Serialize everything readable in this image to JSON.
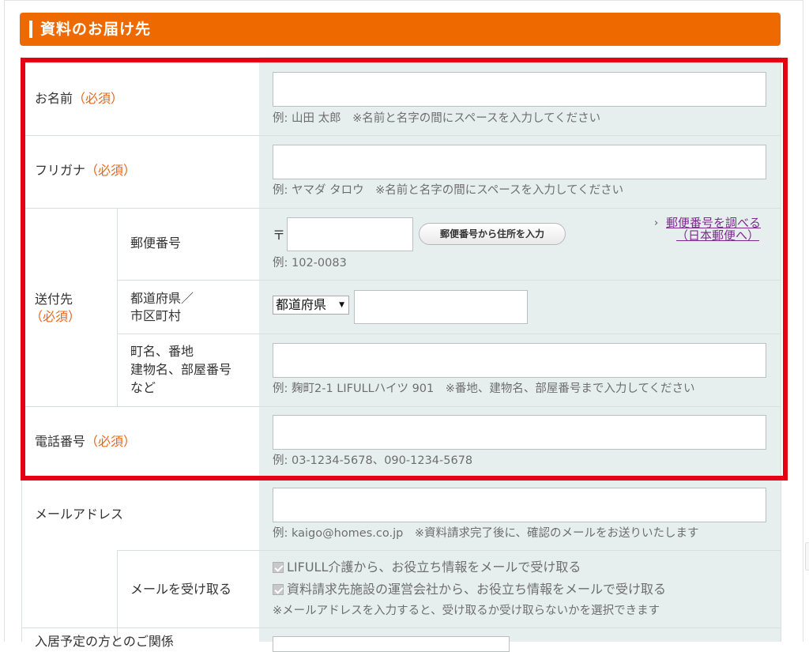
{
  "section": {
    "title": "資料のお届け先"
  },
  "fields": {
    "name": {
      "label": "お名前",
      "required": "（必須）",
      "value": "",
      "hint": "例: 山田 太郎　※名前と名字の間にスペースを入力してください"
    },
    "kana": {
      "label": "フリガナ",
      "required": "（必須）",
      "value": "",
      "hint": "例: ヤマダ タロウ　※名前と名字の間にスペースを入力してください"
    },
    "address": {
      "label": "送付先",
      "required": "（必須）",
      "postal": {
        "label": "郵便番号",
        "mark": "〒",
        "value": "",
        "button": "郵便番号から住所を入力",
        "hint": "例: 102-0083",
        "link_prefix": "›",
        "link_line1": "郵便番号を調べる",
        "link_line2": "（日本郵便へ）"
      },
      "prefecture": {
        "label_line1": "都道府県／",
        "label_line2": "市区町村",
        "select": "都道府県",
        "select_arrow": "▼",
        "city_value": ""
      },
      "street": {
        "label_line1": "町名、番地",
        "label_line2": "建物名、部屋番号",
        "label_line3": "など",
        "value": "",
        "hint": "例: 麹町2-1 LIFULLハイツ 901　※番地、建物名、部屋番号まで入力してください"
      }
    },
    "phone": {
      "label": "電話番号",
      "required": "（必須）",
      "value": "",
      "hint": "例: 03-1234-5678、090-1234-5678"
    },
    "email": {
      "label": "メールアドレス",
      "value": "",
      "hint": "例: kaigo@homes.co.jp　※資料請求完了後に、確認のメールをお送りいたします",
      "receive": {
        "label": "メールを受け取る",
        "option1": "LIFULL介護から、お役立ち情報をメールで受け取る",
        "option2": "資料請求先施設の運営会社から、お役立ち情報をメールで受け取る",
        "note": "※メールアドレスを入力すると、受け取るか受け取らないかを選択できます"
      }
    },
    "relation": {
      "label": "入居予定の方とのご関係"
    }
  },
  "colors": {
    "header": "#ee6a00",
    "required": "#e8671b",
    "highlight_frame": "#e60012",
    "input_bg": "#e6efee",
    "link": "#7d2a8f"
  }
}
